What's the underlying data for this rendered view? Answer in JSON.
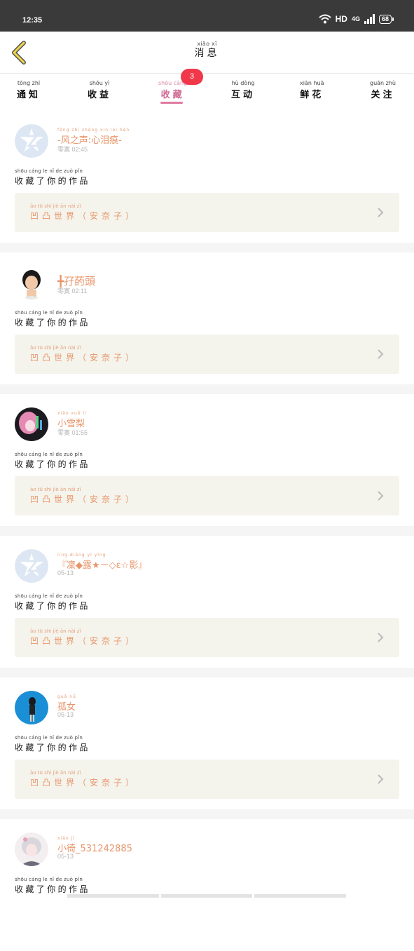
{
  "status_bar": {
    "time": "12:35",
    "network": "HD",
    "signal": "4G",
    "battery": "68"
  },
  "nav": {
    "title_pinyin": "xiāo xī",
    "title": "消息"
  },
  "tabs": [
    {
      "pinyin": "tōng zhī",
      "label": "通知"
    },
    {
      "pinyin": "shōu yì",
      "label": "收益"
    },
    {
      "pinyin": "shōu cáng",
      "label": "收藏",
      "badge": "3",
      "active": true
    },
    {
      "pinyin": "hù dòng",
      "label": "互动"
    },
    {
      "pinyin": "xiān huā",
      "label": "鲜花"
    },
    {
      "pinyin": "guān zhù",
      "label": "关注"
    }
  ],
  "action": {
    "pinyin": "shōu cáng  le   nǐ   de  zuò  pǐn",
    "text": "收藏了你的作品"
  },
  "work": {
    "pinyin": "āo    tū    shì   jiè       ān   nài   zǐ",
    "title": "凹凸世界（安奈子）"
  },
  "items": [
    {
      "name_pinyin": "fēng zhī shēng   xīn  lèi  hén",
      "name": "-风之声:心泪痕-",
      "time": "零寞 02:45",
      "avatar": "z-logo"
    },
    {
      "name_pinyin": "",
      "name": "╋孖菂頭",
      "time": "零寞 02:11",
      "avatar": "boy-photo"
    },
    {
      "name_pinyin": "xiǎo xuě  lì",
      "name": "小雪梨",
      "time": "零寞 01:55",
      "avatar": "anime-girl"
    },
    {
      "name_pinyin": "líng      diāng      yī         yǐng",
      "name": "『凜◆露★ㄧ◇ɛ☆影』",
      "time": "05-13",
      "avatar": "z-logo"
    },
    {
      "name_pinyin": "guǎ nǚ",
      "name": "孤女",
      "time": "05-13",
      "avatar": "girl-blue"
    },
    {
      "name_pinyin": "xiǎo jǐ",
      "name": "小徛_531242885",
      "time": "05-13",
      "avatar": "anime-white"
    }
  ]
}
